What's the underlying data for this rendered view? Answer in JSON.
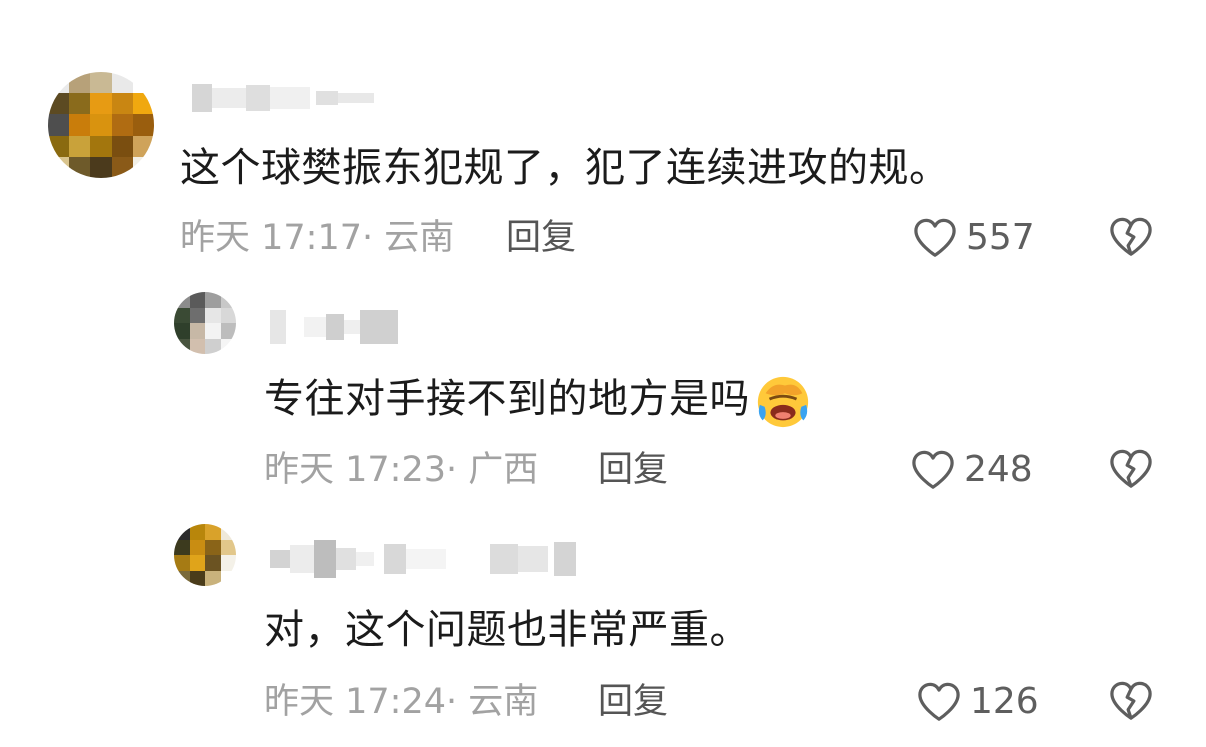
{
  "comments": [
    {
      "text": "这个球樊振东犯规了，犯了连续进攻的规。",
      "meta": "昨天 17:17· 云南",
      "reply_label": "回复",
      "likes": "557"
    },
    {
      "text": "专往对手接不到的地方是吗",
      "emoji": "face-with-tears-of-joy-covering-face-icon",
      "meta": "昨天 17:23· 广西",
      "reply_label": "回复",
      "likes": "248"
    },
    {
      "text": "对，这个问题也非常严重。",
      "meta": "昨天 17:24· 云南",
      "reply_label": "回复",
      "likes": "126"
    }
  ],
  "icons": {
    "like": "heart-outline-icon",
    "dislike": "broken-heart-icon"
  },
  "colors": {
    "text": "#1b1b1b",
    "meta": "#a2a2a2",
    "reply": "#555555",
    "icon": "#5e5e5e",
    "emoji_face": "#ffc93a",
    "emoji_tears": "#3aa3f0"
  }
}
